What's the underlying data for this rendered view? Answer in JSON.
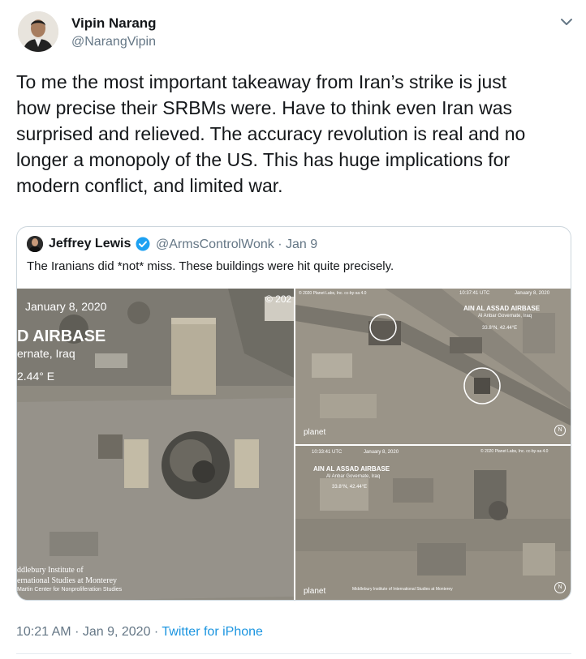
{
  "author": {
    "name": "Vipin Narang",
    "handle": "@NarangVipin"
  },
  "tweet": {
    "text": "To me the most important takeaway from Iran’s strike is just\nhow precise their SRBMs were. Have to think even Iran was\nsurprised and relieved. The accuracy revolution is real and no\nlonger a monopoly of the US. This has huge implications for\nmodern conflict, and limited war."
  },
  "quoted": {
    "name": "Jeffrey Lewis",
    "handle": "@ArmsControlWonk",
    "separator": "·",
    "date": "Jan 9",
    "text": "The Iranians did *not* miss. These buildings were hit quite precisely.",
    "images": {
      "left": {
        "date": "January 8, 2020",
        "title": "D AIRBASE",
        "subtitle": "ernate, Iraq",
        "coord": "2.44° E",
        "corner": "© 202",
        "credit_line1": "ddlebury Institute of",
        "credit_line2": "ernational Studies at Monterey",
        "credit_line3": "Martin Center for Nonproliferation Studies"
      },
      "top_right": {
        "copyright": "© 2020 Planet Labs, Inc. cc-by-sa 4.0",
        "time": "10:37:41 UTC",
        "date": "January 8, 2020",
        "title": "AIN AL ASSAD AIRBASE",
        "subtitle": "Al Anbar Governate, Iraq",
        "coord": "33.8°N, 42.44°E",
        "logo": "planet",
        "north": "N"
      },
      "bottom_right": {
        "time": "10:33:41 UTC",
        "date": "January 8, 2020",
        "copyright": "© 2020 Planet Labs, Inc. cc-by-sa 4.0",
        "title": "AIN AL ASSAD AIRBASE",
        "subtitle": "Al Anbar Governate, Iraq",
        "coord": "33.8°N, 42.44°E",
        "logo": "planet",
        "credit": "Middlebury Institute of International Studies at Monterey",
        "north": "N"
      }
    }
  },
  "footer": {
    "time": "10:21 AM",
    "sep1": "·",
    "date": "Jan 9, 2020",
    "sep2": "·",
    "source": "Twitter for iPhone"
  },
  "colors": {
    "link": "#1b95e0",
    "muted": "#657786",
    "text": "#14171a",
    "verified": "#1da1f2"
  },
  "icons": {
    "menu": "chevron-down-icon",
    "verified": "verified-badge-icon"
  }
}
